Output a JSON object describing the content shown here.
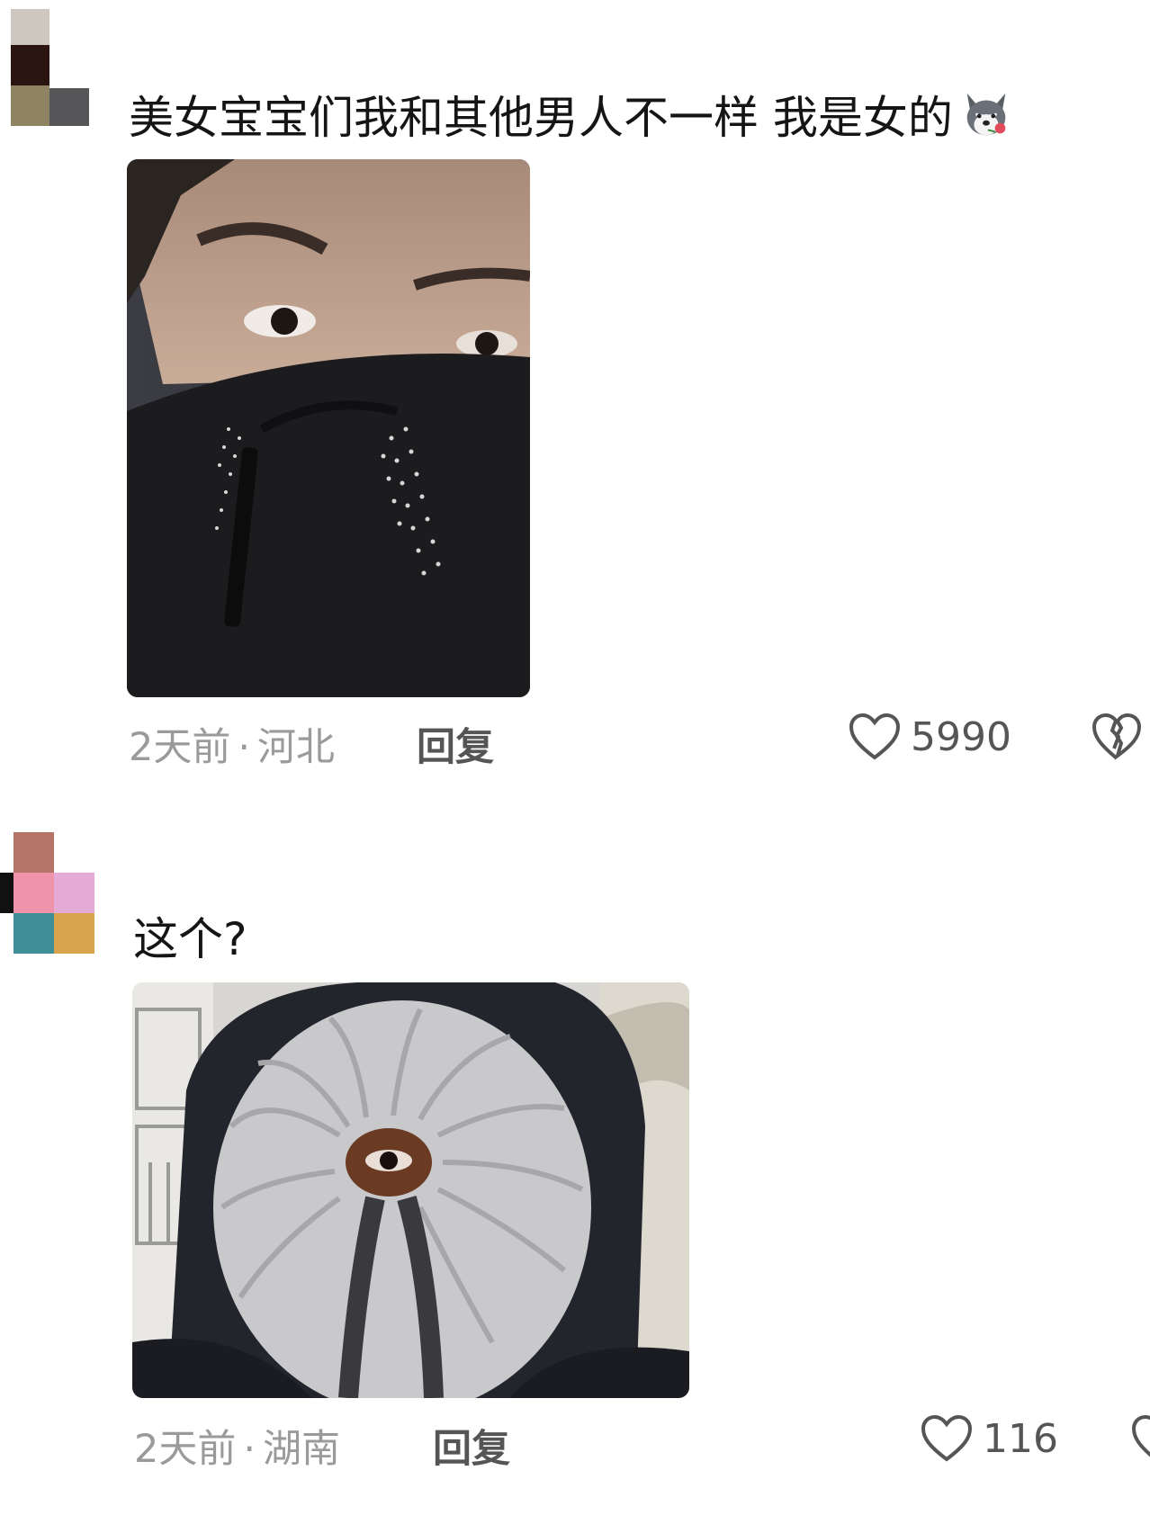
{
  "comments": [
    {
      "text": "美女宝宝们我和其他男人不一样 我是女的",
      "emoji": "husky-with-rose-emoji",
      "image": "person-covered-face-jacket-photo",
      "time": "2天前",
      "separator": "·",
      "location": "河北",
      "reply_label": "回复",
      "likes": "5990",
      "avatar_colors": [
        "#cdc7bf",
        "#2a1510",
        "#8e8461",
        "#565658"
      ]
    },
    {
      "text": "这个?",
      "image": "person-in-hood-eye-photo",
      "time": "2天前",
      "separator": "·",
      "location": "湖南",
      "reply_label": "回复",
      "likes": "116",
      "avatar_colors": [
        "#b67468",
        "#ef93ab",
        "#e6aad6",
        "#3e8f98",
        "#d9a44d",
        "#111111"
      ]
    }
  ]
}
